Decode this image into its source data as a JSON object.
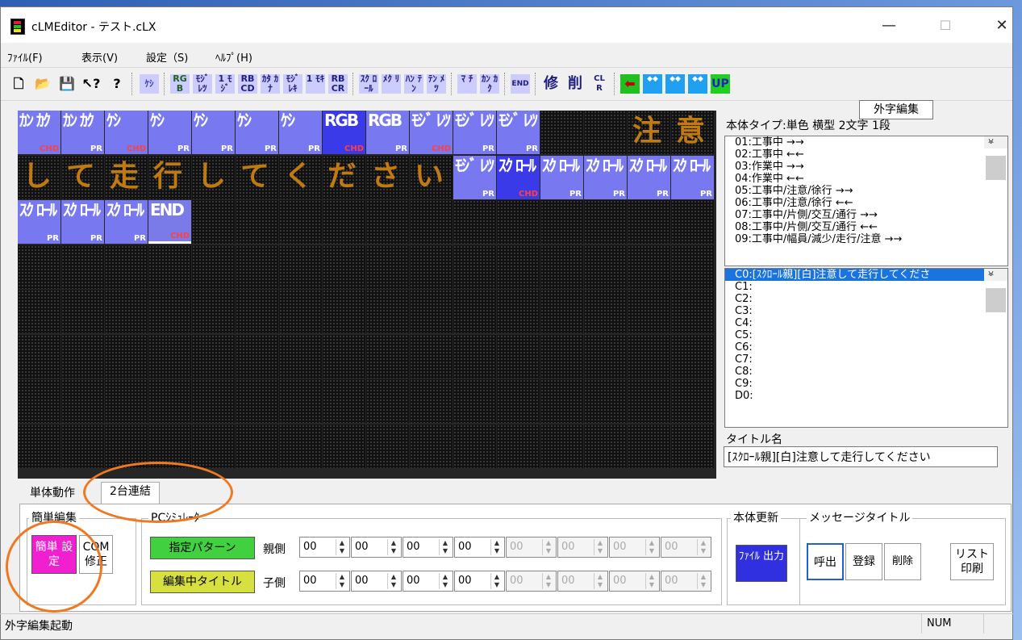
{
  "window": {
    "title": "cLMEditor - テスト.cLX"
  },
  "window_buttons": {
    "minimize": "—",
    "maximize": "☐",
    "close": "✕"
  },
  "menu": [
    "ﾌｧｲﾙ(F)",
    "表示(V)",
    "設定（S)",
    "ﾍﾙﾌﾟ(H)"
  ],
  "toolbar": {
    "icons": [
      "new-file-icon",
      "open-file-icon",
      "save-icon",
      "context-help-icon",
      "help-icon"
    ],
    "buttons": [
      "ｹｼ",
      "RG B",
      "ﾓｼﾞ ﾚﾂ",
      "1 ﾓｼﾞ",
      "RB CD",
      "ｶﾀ ｶﾅ",
      "ﾓｼﾞ ﾚｷ",
      "1 ﾓｷ",
      "RB CR",
      "ｽｸ ﾛｰﾙ",
      "ﾒｸ ﾘ",
      "ﾊﾝ ﾃﾝ",
      "ﾃﾝ ﾒﾂ",
      "ﾏ ﾁ",
      "ｶﾝ ｶｸ",
      "END",
      "修",
      "削",
      "CL R",
      "",
      "",
      "",
      "UP"
    ],
    "tooltip": "外字編集"
  },
  "grid": {
    "row1": [
      {
        "t": "ｶﾝ ｶｸ",
        "s": "CHD"
      },
      {
        "t": "ｶﾝ ｶｸ",
        "s": "PR"
      },
      {
        "t": "ｹｼ",
        "s": "CHD"
      },
      {
        "t": "ｹｼ",
        "s": "PR"
      },
      {
        "t": "ｹｼ",
        "s": "PR"
      },
      {
        "t": "ｹｼ",
        "s": "PR"
      },
      {
        "t": "ｹｼ",
        "s": "PR"
      },
      {
        "t": "RGB",
        "s": "CHD"
      },
      {
        "t": "RGB",
        "s": "PR"
      },
      {
        "t": "ﾓｼﾞ ﾚﾂ",
        "s": "CHD"
      },
      {
        "t": "ﾓｼﾞ ﾚﾂ",
        "s": "PR"
      },
      {
        "t": "ﾓｼﾞ ﾚﾂ",
        "s": "PR"
      }
    ],
    "row1_chars": [
      "注",
      "意"
    ],
    "row2_chars": [
      "し",
      "て",
      "走",
      "行",
      "し",
      "て",
      "く",
      "だ",
      "さ",
      "い"
    ],
    "row2_cells": [
      {
        "t": "ﾓｼﾞ ﾚﾂ",
        "s": "PR"
      },
      {
        "t": "ｽｸ ﾛｰﾙ",
        "s": "CHD"
      },
      {
        "t": "ｽｸ ﾛｰﾙ",
        "s": "PR"
      },
      {
        "t": "ｽｸ ﾛｰﾙ",
        "s": "PR"
      },
      {
        "t": "ｽｸ ﾛｰﾙ",
        "s": "PR"
      },
      {
        "t": "ｽｸ ﾛｰﾙ",
        "s": "PR"
      }
    ],
    "row3": [
      {
        "t": "ｽｸ ﾛｰﾙ",
        "s": "PR"
      },
      {
        "t": "ｽｸ ﾛｰﾙ",
        "s": "PR"
      },
      {
        "t": "ｽｸ ﾛｰﾙ",
        "s": "PR"
      },
      {
        "t": "END",
        "s": "CHD"
      }
    ]
  },
  "right": {
    "type_label": "本体タイプ:単色 横型 2文字 1段",
    "patterns": [
      "01:工事中 →→",
      "02:工事中 ←←",
      "03:作業中 →→",
      "04:作業中 ←←",
      "05:工事中/注意/徐行 →→",
      "06:工事中/注意/徐行 ←←",
      "07:工事中/片側/交互/通行 →→",
      "08:工事中/片側/交互/通行 ←←",
      "09:工事中/幅員/減少/走行/注意 →→"
    ],
    "messages": [
      "C0:[ｽｸﾛｰﾙ親][白]注意して走行してくださ",
      "C1:",
      "C2:",
      "C3:",
      "C4:",
      "C5:",
      "C6:",
      "C7:",
      "C8:",
      "C9:",
      "D0:"
    ],
    "title_label": "タイトル名",
    "title_value": "[ｽｸﾛｰﾙ親][白]注意して走行してください"
  },
  "tabs": [
    "単体動作",
    "2台連結"
  ],
  "bottom": {
    "easy_edit": "簡単編集",
    "easy_setup": "簡単 設定",
    "com_fix": "COM 修正",
    "pc_sim": "PCｼﾐｭﾚｰﾀ",
    "pattern_btn": "指定パターン",
    "title_btn": "編集中タイトル",
    "parent": "親側",
    "child": "子側",
    "spin_value": "00",
    "body_update": "本体更新",
    "file_out": "ﾌｧｲﾙ 出力",
    "msg_title": "メッセージタイトル",
    "call": "呼出",
    "register": "登録",
    "delete": "削除",
    "list_print": "リスト 印刷"
  },
  "status": {
    "left": "外字編集起動",
    "num": "NUM"
  }
}
